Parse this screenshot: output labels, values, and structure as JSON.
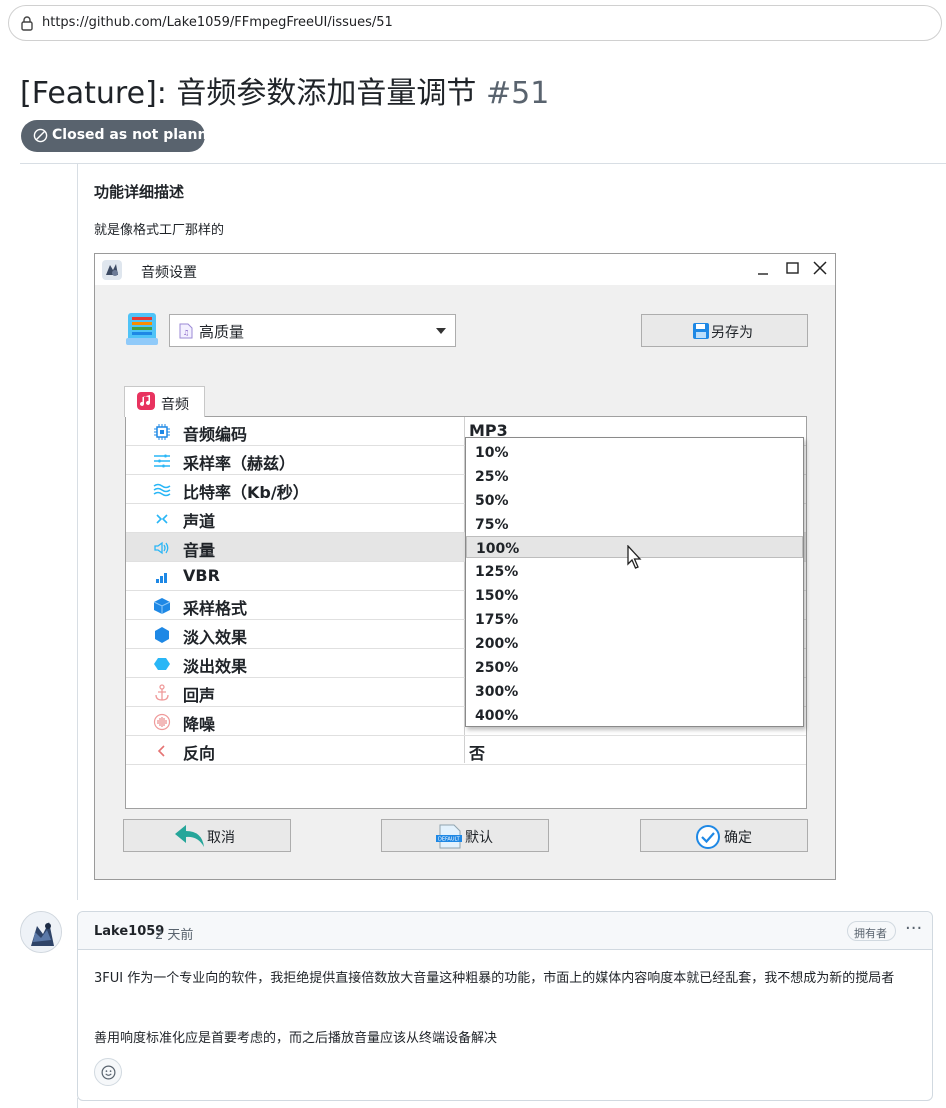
{
  "browser": {
    "url": "https://github.com/Lake1059/FFmpegFreeUI/issues/51"
  },
  "issue": {
    "title": "[Feature]: 音频参数添加音量调节",
    "number": "#51",
    "state": "Closed as not planned"
  },
  "body": {
    "heading": "功能详细描述",
    "text": "就是像格式工厂那样的"
  },
  "dialog": {
    "title": "音频设置",
    "preset": "高质量",
    "save_as": "另存为",
    "tab": "音频",
    "rows": [
      {
        "name": "音频编码",
        "value": "MP3",
        "icon": "chip-icon"
      },
      {
        "name": "采样率（赫兹）",
        "value": "",
        "icon": "sample-rate-icon"
      },
      {
        "name": "比特率（Kb/秒）",
        "value": "",
        "icon": "wave-icon"
      },
      {
        "name": "声道",
        "value": "",
        "icon": "channel-icon"
      },
      {
        "name": "音量",
        "value": "",
        "icon": "speaker-icon"
      },
      {
        "name": "VBR",
        "value": "",
        "icon": "vbr-icon"
      },
      {
        "name": "采样格式",
        "value": "",
        "icon": "cube-icon"
      },
      {
        "name": "淡入效果",
        "value": "",
        "icon": "hexagon-icon"
      },
      {
        "name": "淡出效果",
        "value": "",
        "icon": "hexagon-small-icon"
      },
      {
        "name": "回声",
        "value": "",
        "icon": "anchor-icon"
      },
      {
        "name": "降噪",
        "value": "",
        "icon": "noise-icon"
      },
      {
        "name": "反向",
        "value": "否",
        "icon": "reverse-icon"
      }
    ],
    "volume_options": [
      "10%",
      "25%",
      "50%",
      "75%",
      "100%",
      "125%",
      "150%",
      "175%",
      "200%",
      "250%",
      "300%",
      "400%"
    ],
    "cancel": "取消",
    "default": "默认",
    "ok": "确定",
    "colors": {
      "accent": "#1e88e5",
      "tab_icon": "#e8335f"
    }
  },
  "comment": {
    "author": "Lake1059",
    "time": "2 天前",
    "role": "拥有者",
    "p1": "3FUI 作为一个专业向的软件，我拒绝提供直接倍数放大音量这种粗暴的功能，市面上的媒体内容响度本就已经乱套，我不想成为新的搅局者",
    "p2": "善用响度标准化应是首要考虑的，而之后播放音量应该从终端设备解决"
  },
  "colors": {
    "badge_closed": "#59636e",
    "border": "#d1d9e0"
  }
}
